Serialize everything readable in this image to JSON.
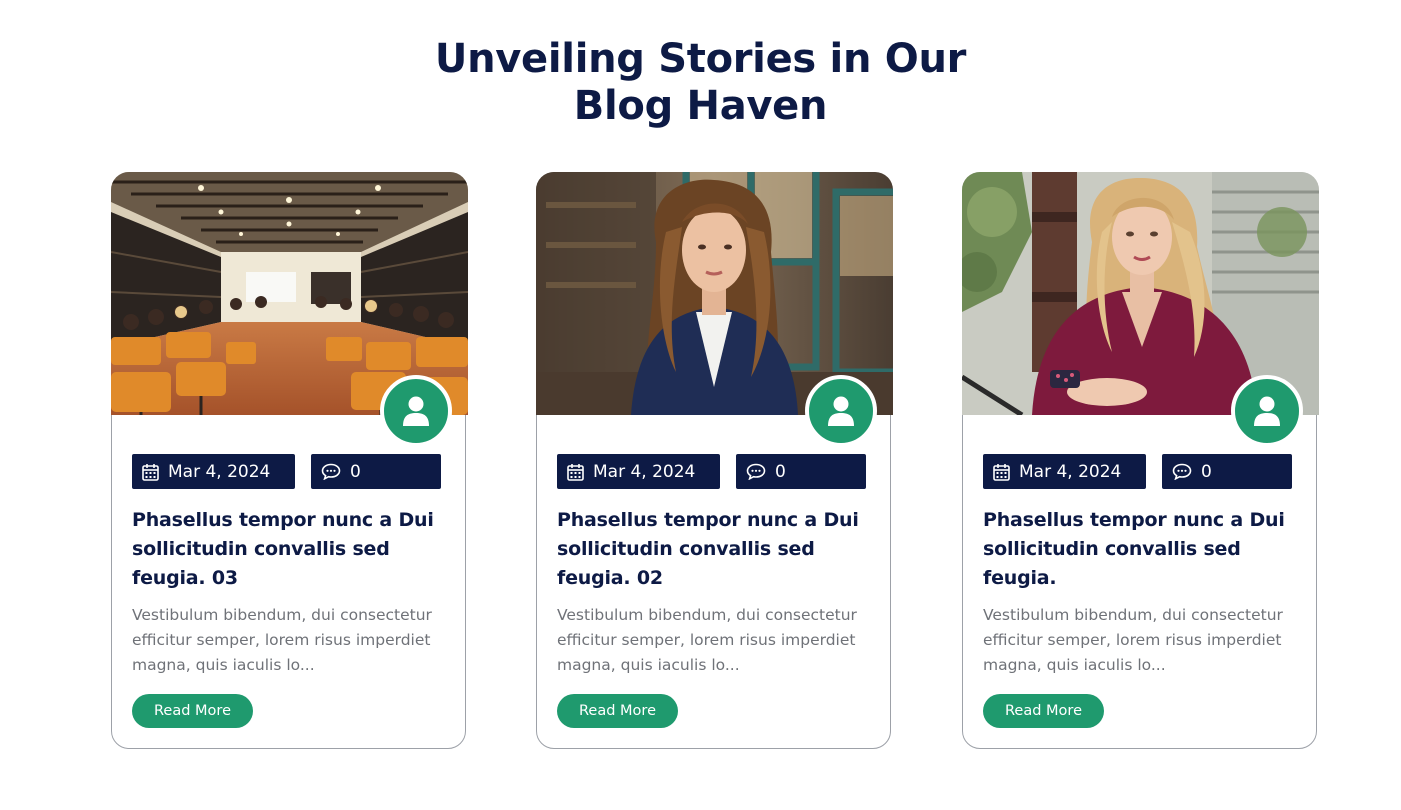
{
  "section": {
    "title_line1": "Unveiling Stories in Our",
    "title_line2": "Blog Haven"
  },
  "colors": {
    "navy": "#0d1a45",
    "green": "#1f9a6e",
    "excerpt_gray": "#6f7278",
    "border": "#9da1a8"
  },
  "icons": {
    "avatar": "user-icon",
    "date": "calendar-icon",
    "comments": "comment-icon"
  },
  "posts": [
    {
      "image": "photo of a lecture hall audience with orange chairs",
      "date": "Mar 4, 2024",
      "comments": "0",
      "title": "Phasellus tempor nunc a Dui sollicitudin convallis sed feugia. 03",
      "excerpt": "Vestibulum bibendum, dui consectetur efficitur semper, lorem risus imperdiet magna, quis iaculis lo...",
      "button": "Read More"
    },
    {
      "image": "photo of a woman in a navy blazer in a cafe",
      "date": "Mar 4, 2024",
      "comments": "0",
      "title": "Phasellus tempor nunc a Dui sollicitudin convallis sed feugia. 02",
      "excerpt": "Vestibulum bibendum, dui consectetur efficitur semper, lorem risus imperdiet magna, quis iaculis lo...",
      "button": "Read More"
    },
    {
      "image": "photo of a blonde woman in a burgundy top holding a phone",
      "date": "Mar 4, 2024",
      "comments": "0",
      "title": "Phasellus tempor nunc a Dui sollicitudin convallis sed feugia.",
      "excerpt": "Vestibulum bibendum, dui consectetur efficitur semper, lorem risus imperdiet magna, quis iaculis lo...",
      "button": "Read More"
    }
  ]
}
